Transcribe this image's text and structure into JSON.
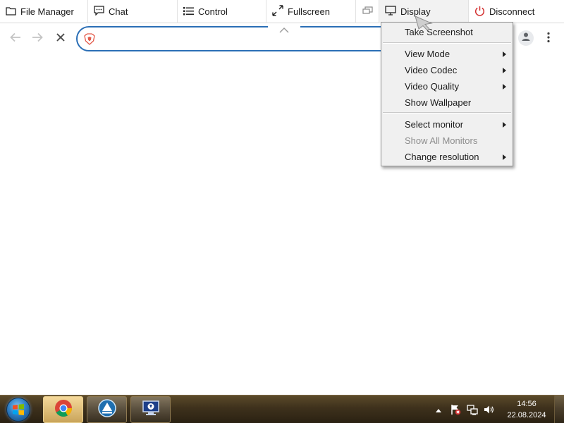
{
  "toolbar": {
    "file_manager": "File Manager",
    "chat": "Chat",
    "control": "Control",
    "fullscreen": "Fullscreen",
    "display": "Display",
    "disconnect": "Disconnect"
  },
  "browser": {
    "address_value": "",
    "address_placeholder": ""
  },
  "display_menu": {
    "items": [
      {
        "label": "Take Screenshot",
        "submenu": false,
        "enabled": true
      },
      {
        "label": "View Mode",
        "submenu": true,
        "enabled": true
      },
      {
        "label": "Video Codec",
        "submenu": true,
        "enabled": true
      },
      {
        "label": "Video Quality",
        "submenu": true,
        "enabled": true
      },
      {
        "label": "Show Wallpaper",
        "submenu": false,
        "enabled": true
      },
      {
        "label": "Select monitor",
        "submenu": true,
        "enabled": true
      },
      {
        "label": "Show All Monitors",
        "submenu": false,
        "enabled": false
      },
      {
        "label": "Change resolution",
        "submenu": true,
        "enabled": true
      }
    ]
  },
  "taskbar": {
    "time": "14:56",
    "date": "22.08.2024",
    "apps": [
      "chrome-icon",
      "update-icon",
      "remote-desktop-icon"
    ]
  },
  "icons": {
    "file_manager": "folder-icon",
    "chat": "chat-icon",
    "control": "list-icon",
    "fullscreen": "expand-icon",
    "multi_monitor": "monitors-icon",
    "display": "monitor-icon",
    "disconnect": "power-icon"
  },
  "colors": {
    "address_border": "#2b6fb6",
    "disconnect_icon": "#d32f2f",
    "menu_bg": "#f0f0f0",
    "taskbar": "#3e311c"
  }
}
